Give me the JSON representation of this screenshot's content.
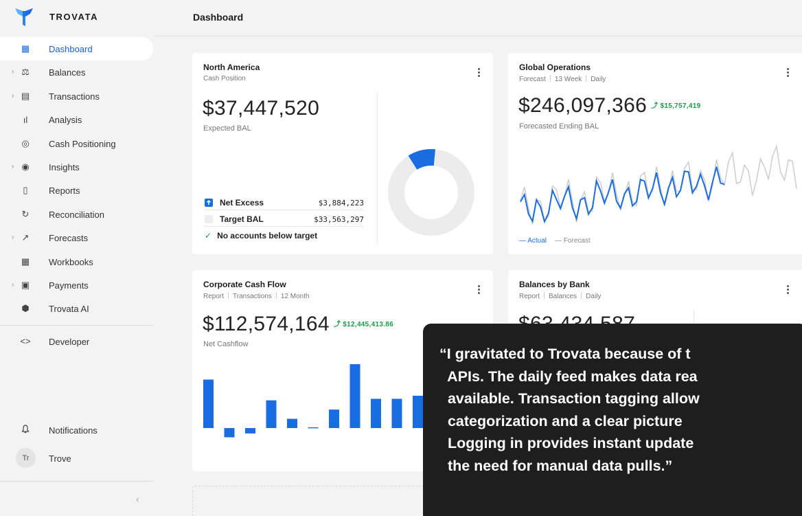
{
  "brand": {
    "name": "TROVATA",
    "colors": {
      "primary": "#1a6de0",
      "positive": "#1a9a4a",
      "quote_bg": "#1e1e1e"
    }
  },
  "sidebar": {
    "items": [
      {
        "label": "Dashboard",
        "icon": "dashboard-icon",
        "active": true,
        "caret": false
      },
      {
        "label": "Balances",
        "icon": "scale-icon",
        "caret": true
      },
      {
        "label": "Transactions",
        "icon": "receipt-icon",
        "caret": true
      },
      {
        "label": "Analysis",
        "icon": "bar-chart-icon",
        "caret": false
      },
      {
        "label": "Cash Positioning",
        "icon": "target-icon",
        "caret": false
      },
      {
        "label": "Insights",
        "icon": "eye-icon",
        "caret": true
      },
      {
        "label": "Reports",
        "icon": "document-icon",
        "caret": false
      },
      {
        "label": "Reconciliation",
        "icon": "sync-icon",
        "caret": false
      },
      {
        "label": "Forecasts",
        "icon": "trend-icon",
        "caret": true
      },
      {
        "label": "Workbooks",
        "icon": "grid-icon",
        "caret": false
      },
      {
        "label": "Payments",
        "icon": "payment-icon",
        "caret": true
      },
      {
        "label": "Trovata AI",
        "icon": "ai-icon",
        "caret": false
      }
    ],
    "developer": "Developer",
    "notifications": "Notifications",
    "user": {
      "initials": "Tr",
      "name": "Trove"
    },
    "collapse": "‹"
  },
  "header": {
    "title": "Dashboard"
  },
  "cards": {
    "north_america": {
      "title": "North America",
      "subtitle": "Cash Position",
      "amount": "$37,447,520",
      "amount_label": "Expected BAL",
      "rows": [
        {
          "label": "Net Excess",
          "value": "$3,884,223"
        },
        {
          "label": "Target BAL",
          "value": "$33,563,297"
        }
      ],
      "note": "No accounts below target",
      "donut_fraction": 0.104
    },
    "global_ops": {
      "title": "Global Operations",
      "subtitle": [
        "Forecast",
        "13 Week",
        "Daily"
      ],
      "amount": "$246,097,366",
      "delta": "$15,757,419",
      "amount_label": "Forecasted Ending BAL",
      "legend_actual": "Actual",
      "legend_forecast": "Forecast"
    },
    "corporate": {
      "title": "Corporate Cash Flow",
      "subtitle": [
        "Report",
        "Transactions",
        "12 Month"
      ],
      "amount": "$112,574,164",
      "delta": "$12,445,413.86",
      "amount_label": "Net Cashflow"
    },
    "banks": {
      "title": "Balances by Bank",
      "subtitle": [
        "Report",
        "Balances",
        "Daily"
      ],
      "amount": "$63,434,587"
    }
  },
  "quote": {
    "lines": [
      "“I gravitated to Trovata because of t",
      "  APIs. The daily feed makes data rea",
      "  available. Transaction tagging allow",
      "  categorization and a clear picture",
      "  Logging in provides instant update",
      "  the need for manual data pulls.”"
    ]
  }
}
